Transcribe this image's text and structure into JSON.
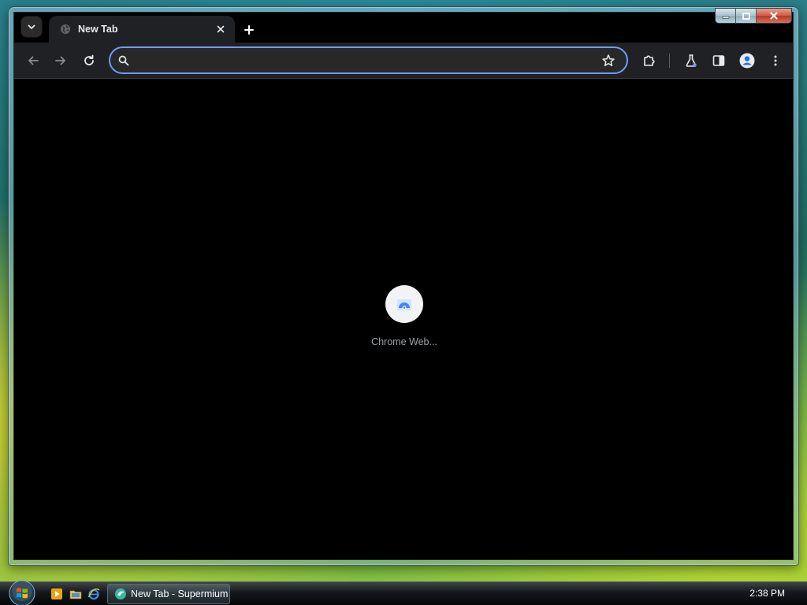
{
  "browser": {
    "tab": {
      "title": "New Tab"
    },
    "omnibox": {
      "value": "",
      "placeholder": ""
    },
    "colors": {
      "accent": "#6f9cf5",
      "toolbar": "#202124",
      "content": "#000000"
    }
  },
  "content": {
    "shortcuts": [
      {
        "label": "Chrome Web..."
      }
    ]
  },
  "taskbar": {
    "items": [
      {
        "label": "New Tab - Supermium"
      }
    ],
    "clock": "2:38 PM"
  }
}
